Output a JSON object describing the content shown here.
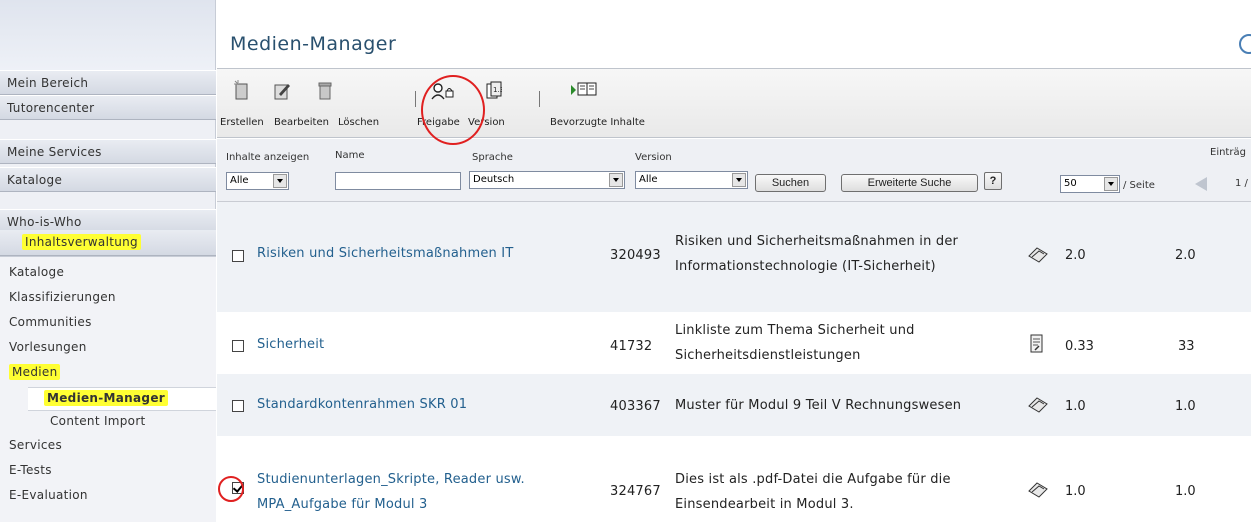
{
  "sidebar": {
    "nav": [
      {
        "label": "Mein Bereich"
      },
      {
        "label": "Tutorencenter"
      },
      {
        "label": "Meine Services"
      },
      {
        "label": "Kataloge"
      },
      {
        "label": "Who-is-Who"
      }
    ],
    "section_label": "Inhaltsverwaltung",
    "sub": [
      {
        "label": "Kataloge"
      },
      {
        "label": "Klassifizierungen"
      },
      {
        "label": "Communities"
      },
      {
        "label": "Vorlesungen"
      },
      {
        "label": "Medien"
      },
      {
        "label": "Medien-Manager"
      },
      {
        "label": "Content Import"
      },
      {
        "label": "Services"
      },
      {
        "label": "E-Tests"
      },
      {
        "label": "E-Evaluation"
      }
    ]
  },
  "header": {
    "title": "Medien-Manager"
  },
  "toolbar": {
    "erstellen": "Erstellen",
    "bearbeiten": "Bearbeiten",
    "loeschen": "Löschen",
    "freigabe": "Freigabe",
    "version": "Version",
    "bevorzugte": "Bevorzugte Inhalte"
  },
  "filter": {
    "inhalte_label": "Inhalte anzeigen",
    "inhalte_value": "Alle",
    "name_label": "Name",
    "name_value": "",
    "sprache_label": "Sprache",
    "sprache_value": "Deutsch",
    "version_label": "Version",
    "version_value": "Alle",
    "suchen": "Suchen",
    "erweiterte": "Erweiterte Suche",
    "help": "?",
    "eintraege_label": "Einträg",
    "per_page_value": "50",
    "per_page_suffix": "/ Seite",
    "page": "1 /"
  },
  "rows": [
    {
      "title": "Risiken und Sicherheitsmaßnahmen IT",
      "id": "320493",
      "desc_line1": "Risiken und Sicherheitsmaßnahmen in der",
      "desc_line2": "Informationstechnologie (IT-Sicherheit)",
      "icon": "eraser-icon",
      "v1": "2.0",
      "v2": "2.0",
      "checked": false
    },
    {
      "title": "Sicherheit",
      "id": "41732",
      "desc_line1": "Linkliste zum Thema Sicherheit und",
      "desc_line2": "Sicherheitsdienstleistungen",
      "icon": "link-list-icon",
      "v1": "0.33",
      "v2": "33",
      "checked": false
    },
    {
      "title": "Standardkontenrahmen SKR 01",
      "id": "403367",
      "desc_line1": "Muster für Modul 9 Teil V Rechnungswesen",
      "icon": "eraser-icon",
      "v1": "1.0",
      "v2": "1.0",
      "checked": false
    },
    {
      "title_line1": "Studienunterlagen_Skripte, Reader usw.",
      "title_line2": "MPA_Aufgabe für Modul 3",
      "id": "324767",
      "desc_line1": "Dies ist als .pdf-Datei die Aufgabe für die",
      "desc_line2": "Einsendearbeit in Modul 3.",
      "icon": "eraser-icon",
      "v1": "1.0",
      "v2": "1.0",
      "checked": true
    }
  ],
  "colors": {
    "highlight": "#ffff33",
    "link": "#23608e",
    "title": "#29506e",
    "annotation": "#e02020"
  }
}
